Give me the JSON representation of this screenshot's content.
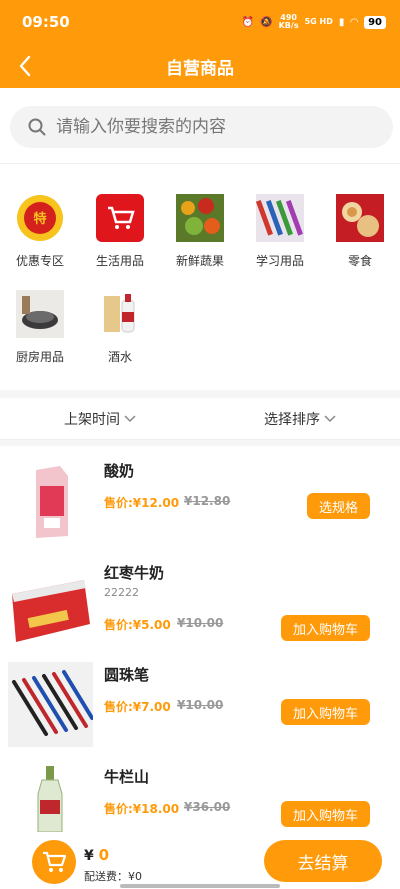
{
  "status": {
    "time": "09:50",
    "net_speed": "490",
    "net_unit": "KB/s",
    "net_type": "5G HD",
    "battery": "90"
  },
  "header": {
    "title": "自营商品"
  },
  "search": {
    "placeholder": "请输入你要搜索的内容"
  },
  "categories": [
    {
      "label": "优惠专区",
      "icon": "promotion-badge-icon"
    },
    {
      "label": "生活用品",
      "icon": "shopping-cart-icon"
    },
    {
      "label": "新鲜蔬果",
      "icon": "vegetables-icon"
    },
    {
      "label": "学习用品",
      "icon": "stationery-icon"
    },
    {
      "label": "零食",
      "icon": "snacks-icon"
    },
    {
      "label": "厨房用品",
      "icon": "kitchenware-icon"
    },
    {
      "label": "酒水",
      "icon": "liquor-icon"
    }
  ],
  "sort": {
    "by_time": "上架时间",
    "by_order": "选择排序"
  },
  "products": [
    {
      "name": "酸奶",
      "spec": "",
      "price": "售价:¥12.00",
      "original": "¥12.80",
      "button": "选规格"
    },
    {
      "name": "红枣牛奶",
      "spec": "22222",
      "price": "售价:¥5.00",
      "original": "¥10.00",
      "button": "加入购物车"
    },
    {
      "name": "圆珠笔",
      "spec": "",
      "price": "售价:¥7.00",
      "original": "¥10.00",
      "button": "加入购物车"
    },
    {
      "name": "牛栏山",
      "spec": "",
      "price": "售价:¥18.00",
      "original": "¥36.00",
      "button": "加入购物车"
    }
  ],
  "cart": {
    "currency": "¥",
    "total": "0",
    "delivery": "配送费：¥0",
    "checkout": "去结算"
  },
  "colors": {
    "accent": "#ff9a0a"
  }
}
